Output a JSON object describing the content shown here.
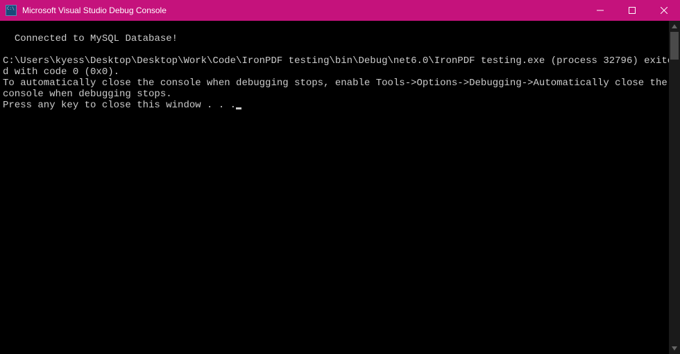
{
  "titlebar": {
    "title": "Microsoft Visual Studio Debug Console"
  },
  "console": {
    "lines": [
      "Connected to MySQL Database!",
      "",
      "C:\\Users\\kyess\\Desktop\\Desktop\\Work\\Code\\IronPDF testing\\bin\\Debug\\net6.0\\IronPDF testing.exe (process 32796) exited with code 0 (0x0).",
      "To automatically close the console when debugging stops, enable Tools->Options->Debugging->Automatically close the console when debugging stops.",
      "Press any key to close this window . . ."
    ]
  }
}
